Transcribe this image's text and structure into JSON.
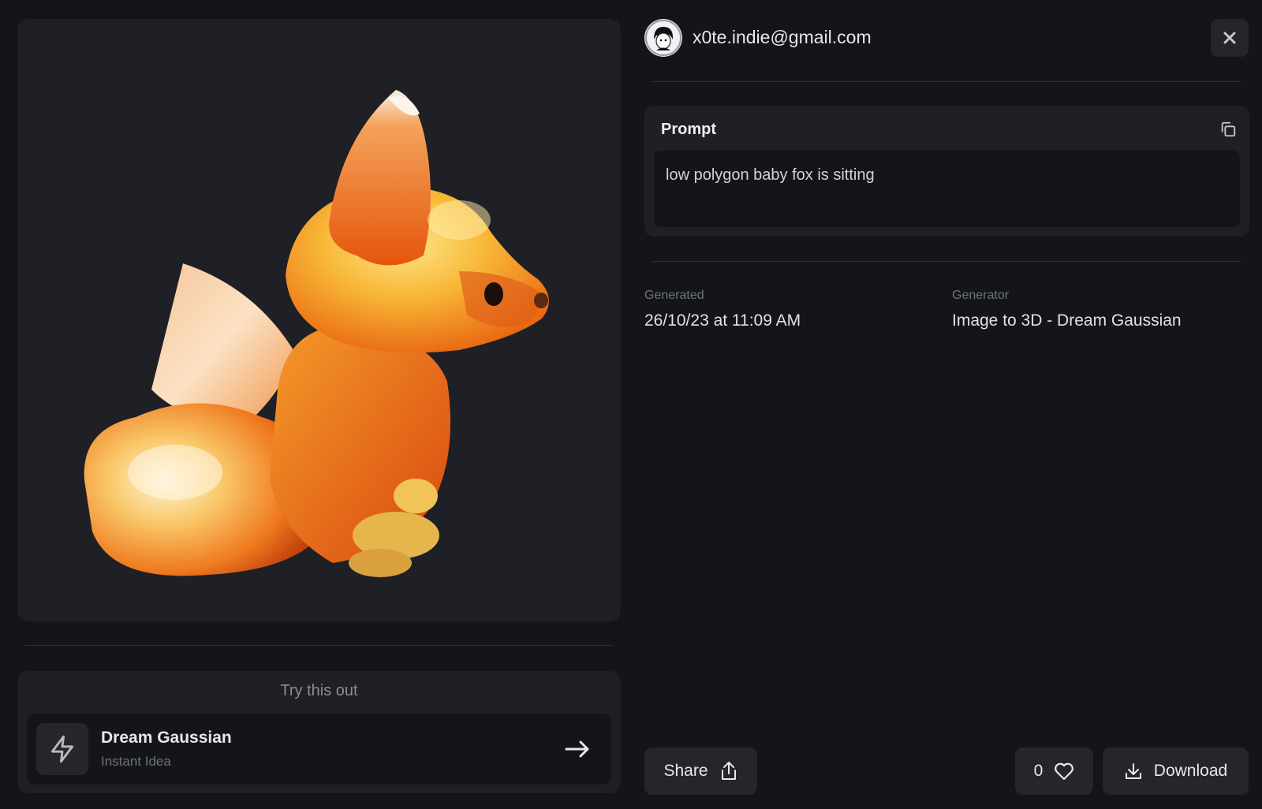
{
  "user": {
    "email": "x0te.indie@gmail.com",
    "avatar_icon": "user-avatar-icon"
  },
  "close_icon": "close-icon",
  "preview": {
    "subject": "low polygon baby fox 3D render"
  },
  "prompt": {
    "label": "Prompt",
    "text": "low polygon baby fox is sitting",
    "copy_icon": "copy-icon"
  },
  "meta": {
    "generated_label": "Generated",
    "generated_value": "26/10/23 at 11:09 AM",
    "generator_label": "Generator",
    "generator_value": "Image to 3D - Dream Gaussian"
  },
  "try_out": {
    "title": "Try this out",
    "item_name": "Dream Gaussian",
    "item_subtitle": "Instant Idea",
    "item_icon": "lightning-icon",
    "arrow_icon": "arrow-right-icon"
  },
  "actions": {
    "share_label": "Share",
    "share_icon": "share-icon",
    "likes_count": "0",
    "like_icon": "heart-icon",
    "download_label": "Download",
    "download_icon": "download-icon"
  },
  "colors": {
    "background": "#131519",
    "panel": "#1f2025",
    "button": "#24262c",
    "fox_orange": "#f07a1a",
    "fox_yellow": "#f5c43b"
  }
}
